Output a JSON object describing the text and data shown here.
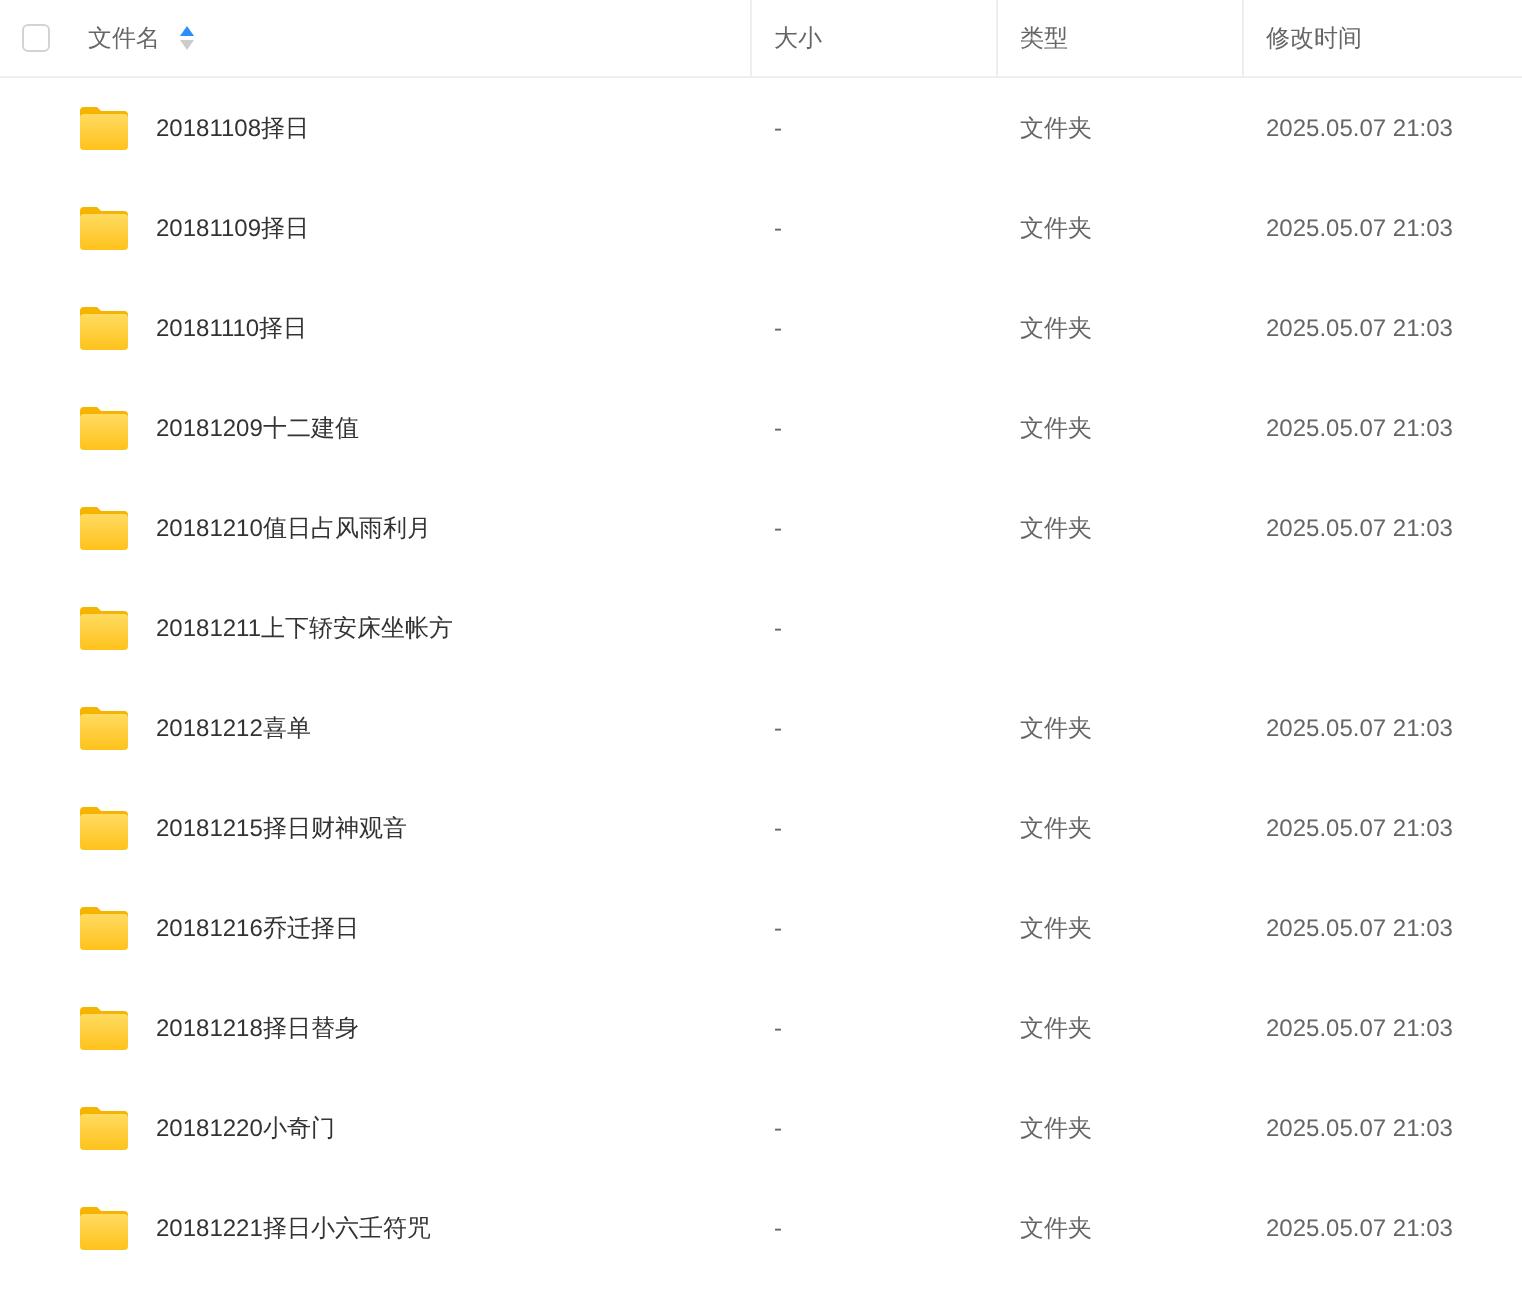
{
  "header": {
    "select_all": {
      "checked": false
    },
    "columns": [
      {
        "label": "文件名",
        "sort_ascending": true
      },
      {
        "label": "大小"
      },
      {
        "label": "类型"
      },
      {
        "label": "修改时间"
      }
    ]
  },
  "rows": [
    {
      "name": "20181108择日",
      "size": "-",
      "type": "文件夹",
      "modified": "2025.05.07 21:03"
    },
    {
      "name": "20181109择日",
      "size": "-",
      "type": "文件夹",
      "modified": "2025.05.07 21:03"
    },
    {
      "name": "20181110择日",
      "size": "-",
      "type": "文件夹",
      "modified": "2025.05.07 21:03"
    },
    {
      "name": "20181209十二建值",
      "size": "-",
      "type": "文件夹",
      "modified": "2025.05.07 21:03"
    },
    {
      "name": "20181210值日占风雨利月",
      "size": "-",
      "type": "文件夹",
      "modified": "2025.05.07 21:03"
    },
    {
      "name": "20181211上下轿安床坐帐方",
      "size": "-"
    },
    {
      "name": "20181212喜单",
      "size": "-",
      "type": "文件夹",
      "modified": "2025.05.07 21:03"
    },
    {
      "name": "20181215择日财神观音",
      "size": "-",
      "type": "文件夹",
      "modified": "2025.05.07 21:03"
    },
    {
      "name": "20181216乔迁择日",
      "size": "-",
      "type": "文件夹",
      "modified": "2025.05.07 21:03"
    },
    {
      "name": "20181218择日替身",
      "size": "-",
      "type": "文件夹",
      "modified": "2025.05.07 21:03"
    },
    {
      "name": "20181220小奇门",
      "size": "-",
      "type": "文件夹",
      "modified": "2025.05.07 21:03"
    },
    {
      "name": "20181221择日小六壬符咒",
      "size": "-",
      "type": "文件夹",
      "modified": "2025.05.07 21:03"
    }
  ]
}
